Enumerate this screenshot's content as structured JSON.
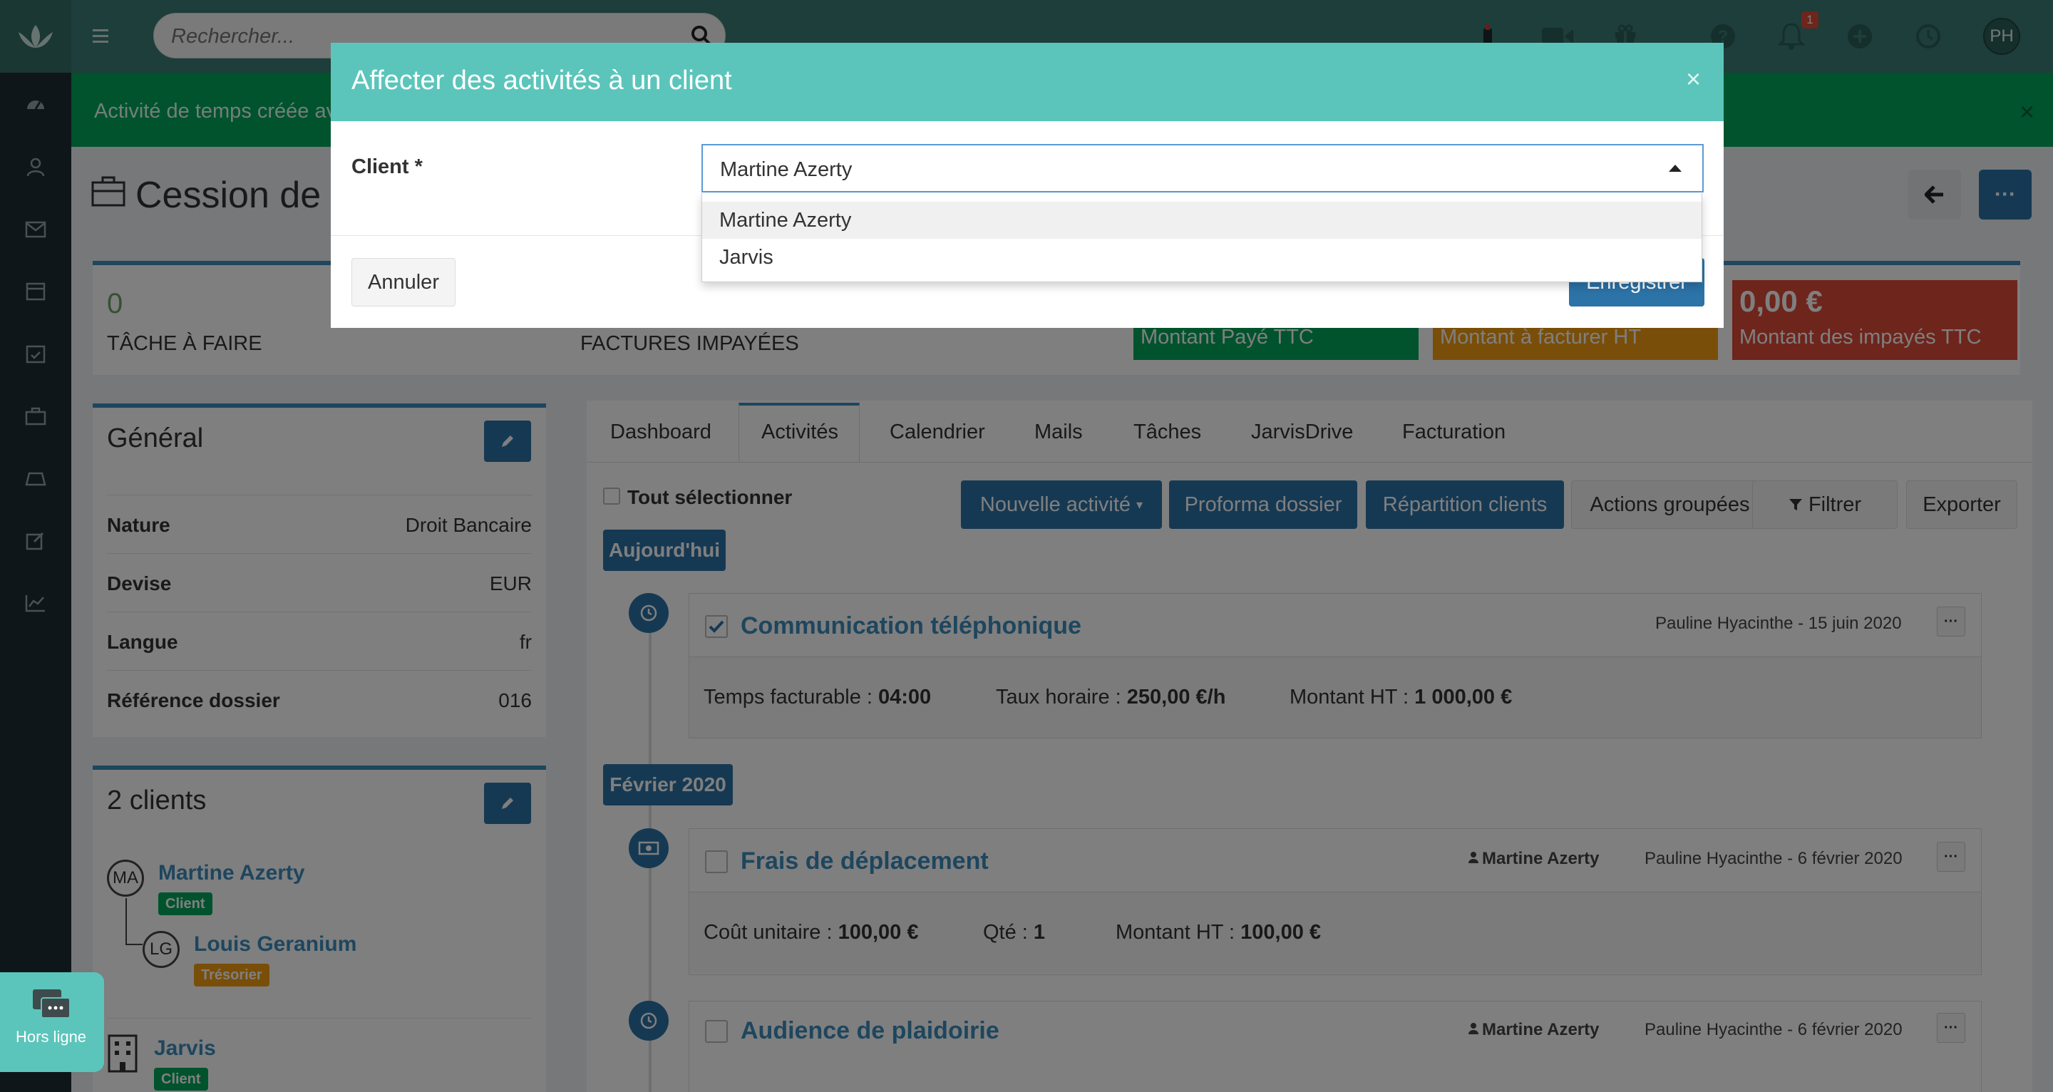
{
  "search": {
    "placeholder": "Rechercher..."
  },
  "topbar": {
    "notif_count": "1",
    "user_initials": "PH"
  },
  "alert": {
    "text": "Activité de temps créée av",
    "close": "×"
  },
  "header": {
    "title": "Cession de c"
  },
  "stats": {
    "tasks_value": "0",
    "tasks_label": "Tâche à faire",
    "invoices_label": "Factures impayées",
    "kpis": [
      {
        "label": "Montant Payé TTC",
        "color": "#00a65a"
      },
      {
        "label": "Montant à facturer HT",
        "color": "#f39c12"
      },
      {
        "value": "0,00 €",
        "label": "Montant des impayés TTC",
        "color": "#dd4b39"
      }
    ]
  },
  "general": {
    "title": "Général",
    "rows": [
      {
        "key": "Nature",
        "value": "Droit Bancaire"
      },
      {
        "key": "Devise",
        "value": "EUR"
      },
      {
        "key": "Langue",
        "value": "fr"
      },
      {
        "key": "Référence dossier",
        "value": "016"
      }
    ]
  },
  "clients": {
    "title": "2 clients",
    "items": [
      {
        "initials": "MA",
        "name": "Martine Azerty",
        "tag": "Client"
      },
      {
        "initials": "LG",
        "name": "Louis Geranium",
        "tag": "Trésorier"
      },
      {
        "name": "Jarvis",
        "tag": "Client"
      }
    ]
  },
  "tabs": [
    "Dashboard",
    "Activités",
    "Calendrier",
    "Mails",
    "Tâches",
    "JarvisDrive",
    "Facturation"
  ],
  "toolbar": {
    "select_all": "Tout sélectionner",
    "new_activity": "Nouvelle activité",
    "proforma": "Proforma dossier",
    "repartition": "Répartition clients",
    "grouped_actions": "Actions groupées",
    "filter": "Filtrer",
    "export": "Exporter"
  },
  "timeline": {
    "today": "Aujourd'hui",
    "feb": "Février 2020",
    "items": [
      {
        "title": "Communication téléphonique",
        "meta": "Pauline Hyacinthe - 15 juin 2020",
        "f1_label": "Temps facturable : ",
        "f1_value": "04:00",
        "f2_label": "Taux horaire : ",
        "f2_value": "250,00 €/h",
        "f3_label": "Montant HT : ",
        "f3_value": "1 000,00 €"
      },
      {
        "title": "Frais de déplacement",
        "client": "Martine Azerty",
        "meta": "Pauline Hyacinthe - 6 février 2020",
        "f1_label": "Coût unitaire : ",
        "f1_value": "100,00 €",
        "f2_label": "Qté : ",
        "f2_value": "1",
        "f3_label": "Montant HT : ",
        "f3_value": "100,00 €"
      },
      {
        "title": "Audience de plaidoirie",
        "client": "Martine Azerty",
        "meta": "Pauline Hyacinthe - 6 février 2020"
      }
    ]
  },
  "modal": {
    "title": "Affecter des activités à un client",
    "close": "×",
    "client_label": "Client *",
    "selected": "Martine Azerty",
    "options": [
      "Martine Azerty",
      "Jarvis"
    ],
    "cancel": "Annuler",
    "save": "Enregistrer"
  },
  "chat": {
    "label": "Hors ligne"
  },
  "colors": {
    "teal": "#5bc5bb",
    "primary": "#2c73a7",
    "link": "#3c8dbc",
    "topbar": "#3a7d74",
    "sidebar": "#1f2d33",
    "success": "#00a65a"
  }
}
